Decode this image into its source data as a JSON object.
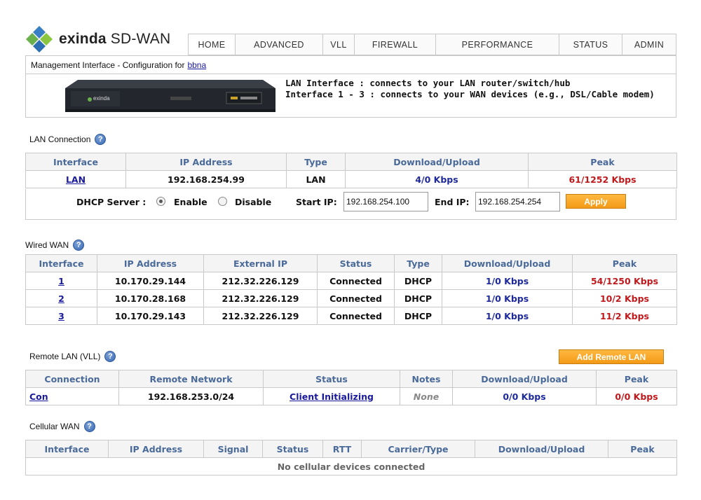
{
  "brand": {
    "name": "exinda",
    "suffix": " SD-WAN"
  },
  "nav": [
    "HOME",
    "ADVANCED",
    "VLL",
    "FIREWALL",
    "PERFORMANCE",
    "STATUS",
    "ADMIN"
  ],
  "management": {
    "prefix": "Management Interface - Configuration for",
    "host": "bbna"
  },
  "device": {
    "badge": "exinda",
    "line1": "LAN Interface : connects to your LAN router/switch/hub",
    "line2": "Interface 1 - 3 : connects to your WAN devices (e.g., DSL/Cable modem)"
  },
  "lan": {
    "title": "LAN Connection",
    "headers": [
      "Interface",
      "IP Address",
      "Type",
      "Download/Upload",
      "Peak"
    ],
    "row": {
      "iface": "LAN",
      "ip": "192.168.254.99",
      "type": "LAN",
      "rate": "4/0 Kbps",
      "peak": "61/1252 Kbps"
    },
    "dhcp": {
      "label": "DHCP Server :",
      "enable": "Enable",
      "disable": "Disable",
      "start_label": "Start IP:",
      "start_value": "192.168.254.100",
      "end_label": "End IP:",
      "end_value": "192.168.254.254",
      "apply": "Apply"
    }
  },
  "wired": {
    "title": "Wired WAN",
    "headers": [
      "Interface",
      "IP Address",
      "External IP",
      "Status",
      "Type",
      "Download/Upload",
      "Peak"
    ],
    "rows": [
      {
        "iface": "1",
        "ip": "10.170.29.144",
        "ext": "212.32.226.129",
        "status": "Connected",
        "type": "DHCP",
        "rate": "1/0 Kbps",
        "peak": "54/1250 Kbps"
      },
      {
        "iface": "2",
        "ip": "10.170.28.168",
        "ext": "212.32.226.129",
        "status": "Connected",
        "type": "DHCP",
        "rate": "1/0 Kbps",
        "peak": "10/2 Kbps"
      },
      {
        "iface": "3",
        "ip": "10.170.29.143",
        "ext": "212.32.226.129",
        "status": "Connected",
        "type": "DHCP",
        "rate": "1/0 Kbps",
        "peak": "11/2 Kbps"
      }
    ]
  },
  "remote": {
    "title": "Remote LAN (VLL)",
    "add_button": "Add Remote LAN",
    "headers": [
      "Connection",
      "Remote Network",
      "Status",
      "Notes",
      "Download/Upload",
      "Peak"
    ],
    "row": {
      "conn": "Con",
      "network": "192.168.253.0/24",
      "status": "Client Initializing",
      "notes": "None",
      "rate": "0/0 Kbps",
      "peak": "0/0 Kbps"
    }
  },
  "cellular": {
    "title": "Cellular WAN",
    "headers": [
      "Interface",
      "IP Address",
      "Signal",
      "Status",
      "RTT",
      "Carrier/Type",
      "Download/Upload",
      "Peak"
    ],
    "empty": "No cellular devices connected"
  }
}
